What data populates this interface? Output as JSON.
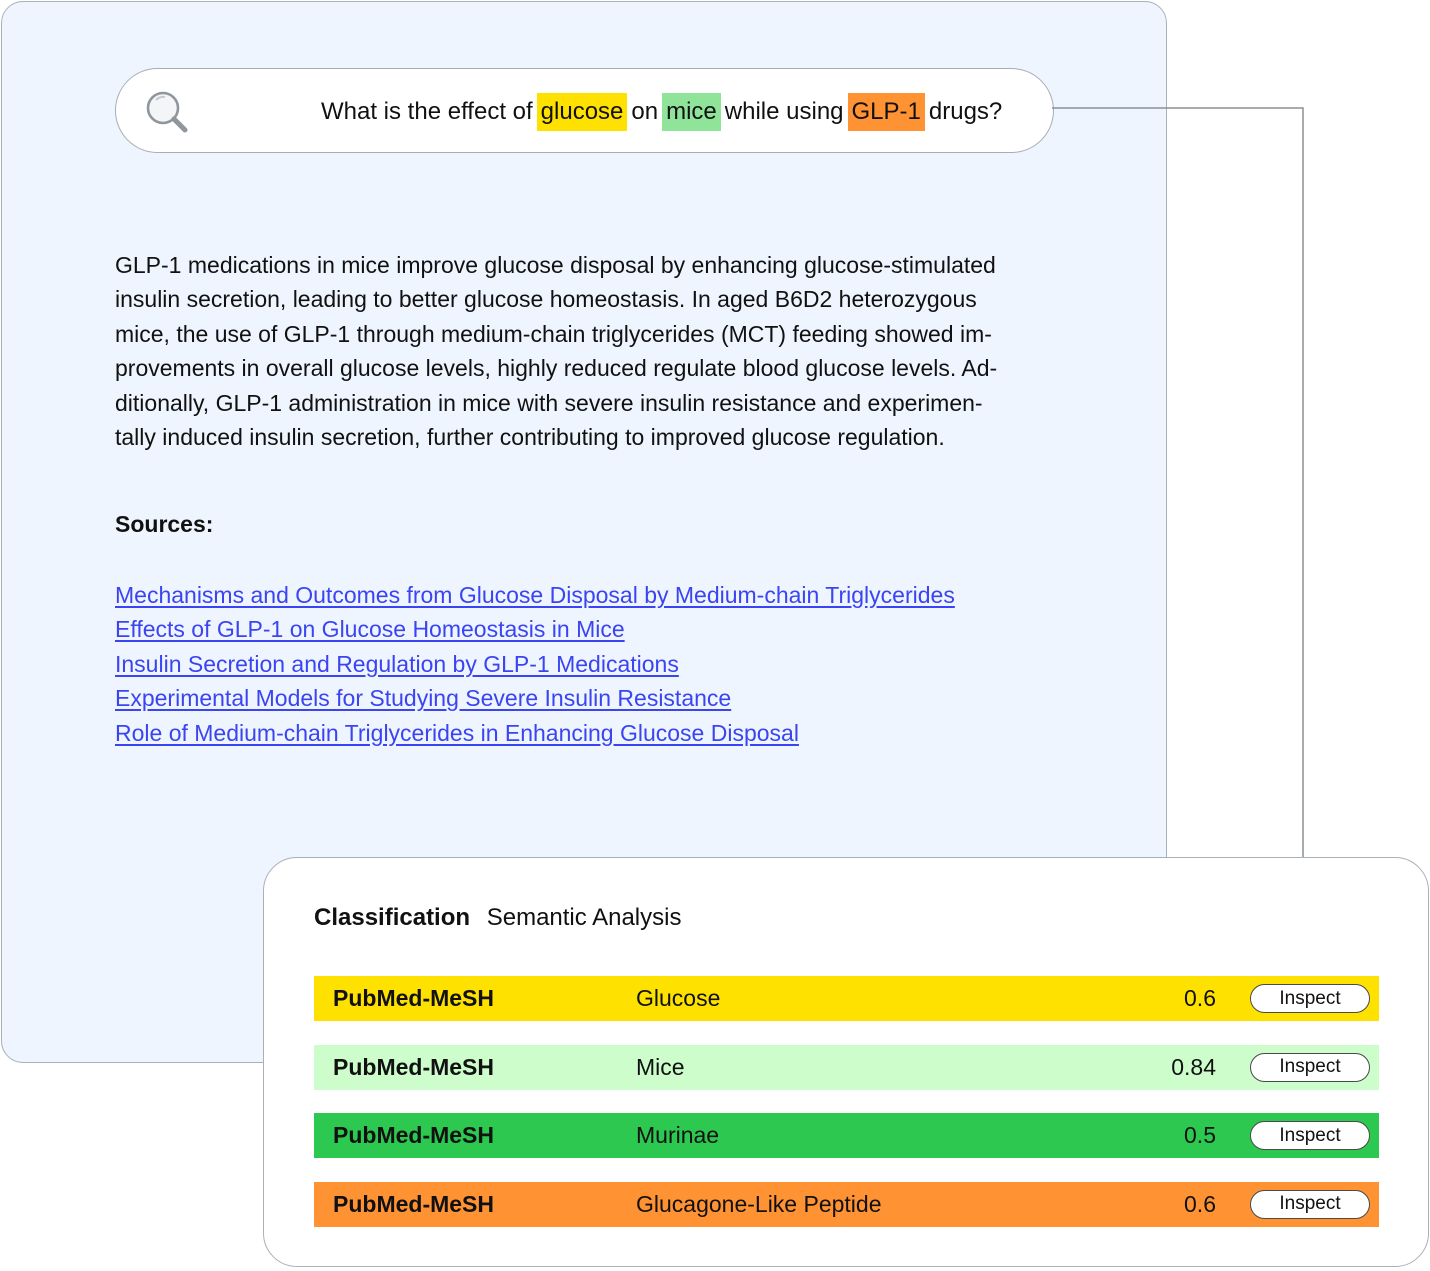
{
  "search": {
    "query_parts": [
      {
        "text": "What is the effect of",
        "highlight": null
      },
      {
        "text": "glucose",
        "highlight": "#ffe100"
      },
      {
        "text": "on",
        "highlight": null
      },
      {
        "text": "mice",
        "highlight": "#8fe49a"
      },
      {
        "text": "while using",
        "highlight": null
      },
      {
        "text": "GLP-1",
        "highlight": "#ff9233"
      },
      {
        "text": "drugs?",
        "highlight": null
      }
    ]
  },
  "answer": {
    "lines": [
      "GLP-1 medications in mice improve glucose disposal by enhancing glucose-stimulated",
      "insulin secretion, leading to better glucose homeostasis. In aged B6D2 heterozygous",
      "mice, the use of GLP-1 through medium-chain triglycerides (MCT) feeding showed im-",
      "provements in overall glucose levels, highly reduced regulate blood glucose levels. Ad-",
      "ditionally, GLP-1 administration in mice with severe insulin resistance and experimen-",
      "tally induced insulin secretion, further contributing to improved glucose regulation."
    ]
  },
  "sources": {
    "heading": "Sources:",
    "links": [
      "Mechanisms and Outcomes from Glucose Disposal by Medium-chain Triglycerides",
      "Effects of GLP-1 on Glucose Homeostasis in Mice",
      "Insulin Secretion and Regulation by GLP-1 Medications",
      "Experimental Models for Studying Severe Insulin Resistance",
      "Role of Medium-chain Triglycerides in Enhancing Glucose Disposal"
    ],
    "link_color": "#3b44f2"
  },
  "classification": {
    "title": "Classification",
    "subtitle": "Semantic Analysis",
    "rows": [
      {
        "source": "PubMed-MeSH",
        "term": "Glucose",
        "score": "0.6",
        "action": "Inspect",
        "color": "#ffe100"
      },
      {
        "source": "PubMed-MeSH",
        "term": "Mice",
        "score": "0.84",
        "action": "Inspect",
        "color": "#ccfdcb"
      },
      {
        "source": "PubMed-MeSH",
        "term": "Murinae",
        "score": "0.5",
        "action": "Inspect",
        "color": "#2cc84f"
      },
      {
        "source": "PubMed-MeSH",
        "term": "Glucagone-Like Peptide",
        "score": "0.6",
        "action": "Inspect",
        "color": "#ff9233"
      }
    ]
  },
  "icons": {
    "search": "search-icon",
    "connector": "connector-arrow"
  }
}
